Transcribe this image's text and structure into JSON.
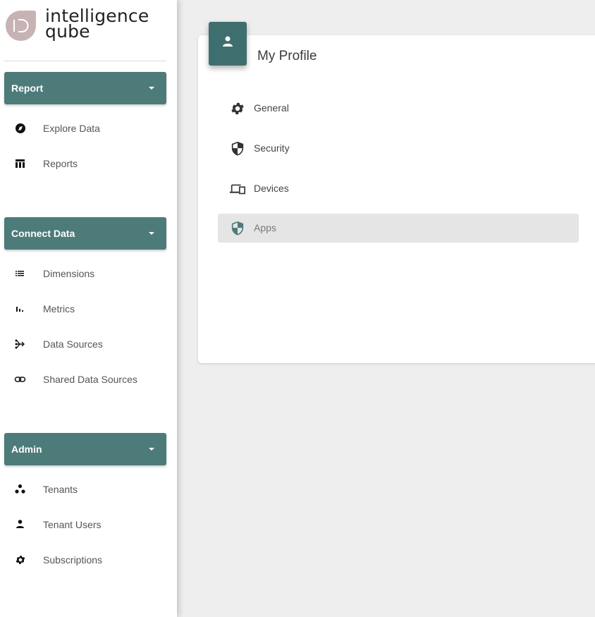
{
  "logo": {
    "line1": "intelligence",
    "line2": "qube"
  },
  "sidebar": {
    "sections": [
      {
        "title": "Report",
        "items": [
          {
            "label": "Explore Data",
            "icon": "compass-icon"
          },
          {
            "label": "Reports",
            "icon": "table-icon"
          }
        ]
      },
      {
        "title": "Connect Data",
        "items": [
          {
            "label": "Dimensions",
            "icon": "list-icon"
          },
          {
            "label": "Metrics",
            "icon": "bar-chart-icon"
          },
          {
            "label": "Data Sources",
            "icon": "data-flow-icon"
          },
          {
            "label": "Shared Data Sources",
            "icon": "link-icon"
          }
        ]
      },
      {
        "title": "Admin",
        "items": [
          {
            "label": "Tenants",
            "icon": "group-icon"
          },
          {
            "label": "Tenant Users",
            "icon": "person-icon"
          },
          {
            "label": "Subscriptions",
            "icon": "gear-icon"
          }
        ]
      }
    ]
  },
  "profile": {
    "title": "My Profile",
    "icon": "person-icon",
    "menu": [
      {
        "label": "General",
        "icon": "gear-icon",
        "active": false
      },
      {
        "label": "Security",
        "icon": "shield-icon",
        "active": false
      },
      {
        "label": "Devices",
        "icon": "devices-icon",
        "active": false
      },
      {
        "label": "Apps",
        "icon": "shield-check-icon",
        "active": true
      }
    ]
  },
  "colors": {
    "accent": "#4d7b7a",
    "accent_dark": "#3e6f6e",
    "background": "#eeeeee",
    "logo": "#c7b3b3"
  }
}
